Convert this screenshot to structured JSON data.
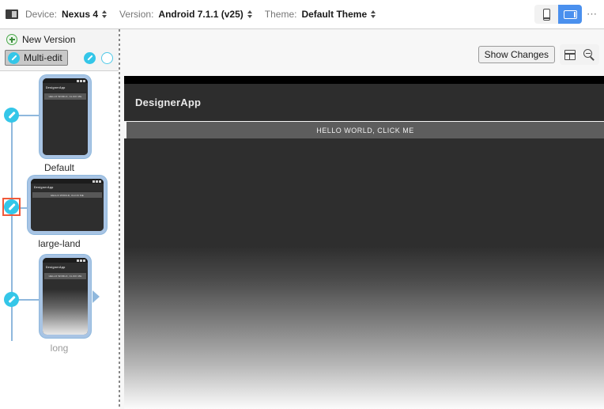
{
  "toolbar": {
    "device_icon": "device-screen-icon",
    "device_label": "Device:",
    "device_value": "Nexus 4",
    "version_label": "Version:",
    "version_value": "Android 7.1.1 (v25)",
    "theme_label": "Theme:",
    "theme_value": "Default Theme",
    "orientation": {
      "portrait_icon": "phone-portrait-icon",
      "landscape_icon": "phone-landscape-icon",
      "selected": "landscape",
      "accent_color": "#4a90ee"
    },
    "overflow_label": "⋯"
  },
  "left_panel": {
    "new_version_label": "New Version",
    "new_version_icon": "plus-circle-icon",
    "multi_edit_label": "Multi-edit",
    "multi_edit_icon": "pencil-circle-icon",
    "multi_edit_pressed": "true",
    "edit_icon": "pencil-circle-icon",
    "empty_circle_icon": "circle-outline-icon",
    "accent_color": "#34c6e8",
    "selection_color": "#f0593a"
  },
  "tree": {
    "nodes": [
      {
        "label": "Default",
        "selected": "false",
        "preview": {
          "app_title": "DesignerApp",
          "button_text": "HELLO WORLD, CLICK ME",
          "style": "solid"
        }
      },
      {
        "label": "large-land",
        "selected": "true",
        "preview": {
          "app_title": "DesignerApp",
          "button_text": "HELLO WORLD, CLICK ME",
          "style": "solid"
        }
      },
      {
        "label": "long",
        "selected": "false",
        "preview": {
          "app_title": "DesignerApp",
          "button_text": "HELLO WORLD, CLICK ME",
          "style": "gradient"
        }
      }
    ]
  },
  "right_panel": {
    "show_changes_label": "Show Changes",
    "split_view_icon": "split-layout-icon",
    "zoom_icon": "zoom-magnifier-icon",
    "preview": {
      "app_title": "DesignerApp",
      "button_text": "HELLO WORLD, CLICK ME"
    }
  }
}
